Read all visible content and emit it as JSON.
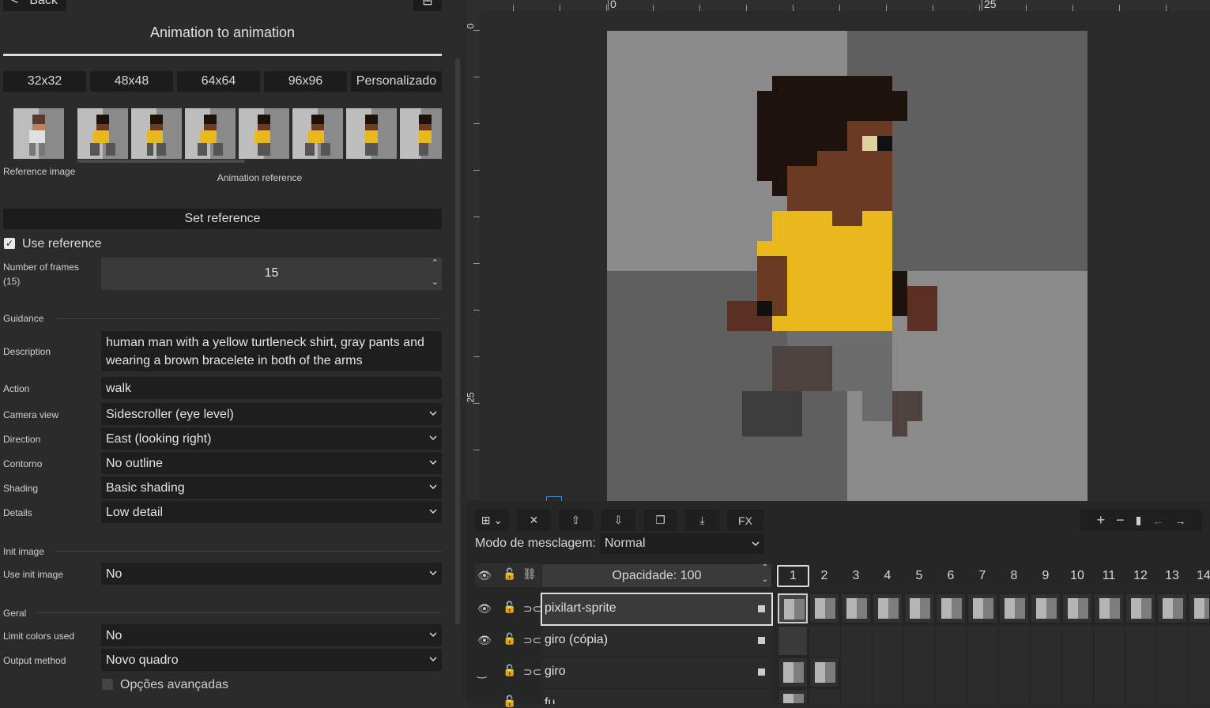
{
  "panel": {
    "back_label": "Back",
    "title": "Animation to animation",
    "sizes": [
      "32x32",
      "48x48",
      "64x64",
      "96x96",
      "Personalizado"
    ],
    "reference_image_label": "Reference image",
    "animation_reference_label": "Animation reference",
    "set_reference_label": "Set reference",
    "use_reference_label": "Use reference",
    "frames_label": "Number of frames",
    "frames_hint": "(15)",
    "frames_value": "15",
    "guidance_section": "Guidance",
    "description_label": "Description",
    "description_value": "human man with a yellow turtleneck shirt, gray pants and wearing a brown bracelete in both of the arms",
    "action_label": "Action",
    "action_value": "walk",
    "camera_label": "Camera view",
    "camera_value": "Sidescroller (eye level)",
    "direction_label": "Direction",
    "direction_value": "East (looking right)",
    "outline_label": "Contorno",
    "outline_value": "No outline",
    "shading_label": "Shading",
    "shading_value": "Basic shading",
    "details_label": "Details",
    "details_value": "Low detail",
    "init_section": "Init image",
    "use_init_label": "Use init image",
    "use_init_value": "No",
    "geral_section": "Geral",
    "limit_colors_label": "Limit colors used",
    "limit_colors_value": "No",
    "output_label": "Output method",
    "output_value": "Novo quadro",
    "advanced_label": "Opções avançadas"
  },
  "ruler": {
    "top_ticks": [
      "0",
      "25"
    ],
    "left_ticks": [
      "0",
      "25"
    ]
  },
  "layers": {
    "blend_label": "Modo de mesclagem:",
    "blend_value": "Normal",
    "opacity_label": "Opacidade: 100",
    "fx_label": "FX",
    "items": [
      {
        "name": "pixilart-sprite"
      },
      {
        "name": "giro (cópia)"
      },
      {
        "name": "giro"
      },
      {
        "name": "fu"
      }
    ],
    "frames": [
      "1",
      "2",
      "3",
      "4",
      "5",
      "6",
      "7",
      "8",
      "9",
      "10",
      "11",
      "12",
      "13",
      "14"
    ]
  }
}
